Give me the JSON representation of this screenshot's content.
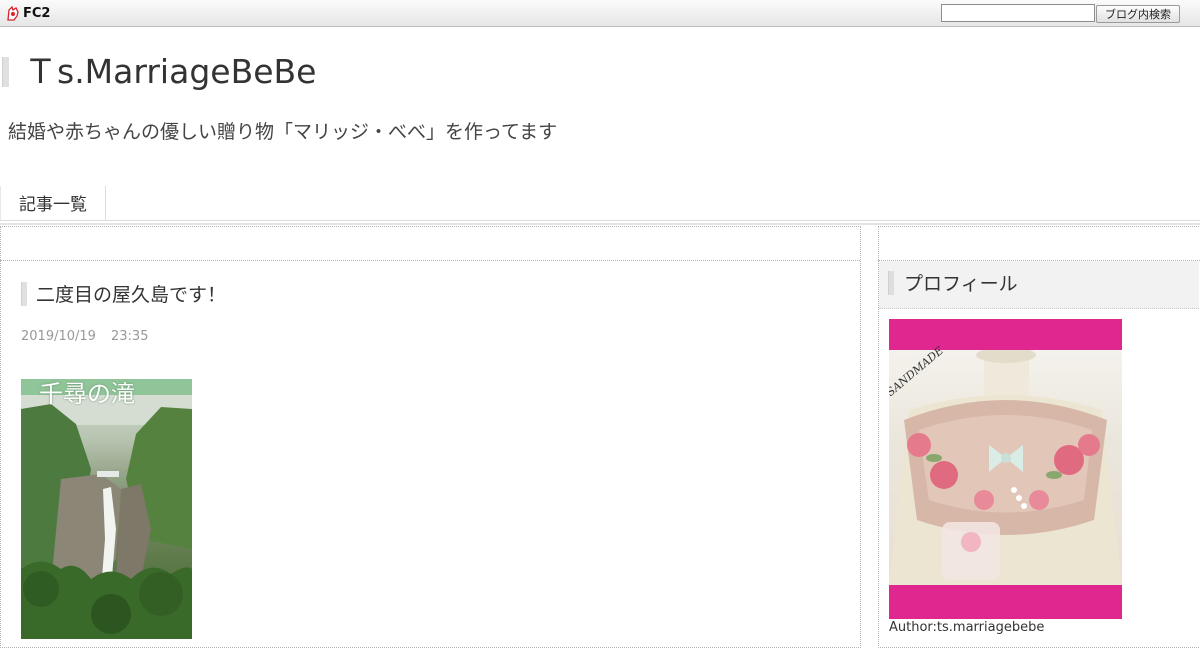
{
  "fc2bar": {
    "logo_text": "FC2",
    "search_value": "",
    "search_button": "ブログ内検索"
  },
  "header": {
    "title": "Ｔs.MarriageBeBe",
    "description": "結婚や赤ちゃんの優しい贈り物「マリッジ・べべ」を作ってます"
  },
  "nav": {
    "items": [
      {
        "label": "記事一覧"
      }
    ]
  },
  "entry": {
    "title": "二度目の屋久島です！",
    "date": "2019/10/19",
    "time": "23:35",
    "photo_caption": "千尋の滝"
  },
  "sidebar": {
    "profile_title": "プロフィール",
    "author_label": "Author:ts.marriagebebe",
    "profile_image_overlay": "SANDMADE"
  },
  "colors": {
    "accent_pink": "#e0278f",
    "text": "#333333",
    "meta": "#999999"
  }
}
